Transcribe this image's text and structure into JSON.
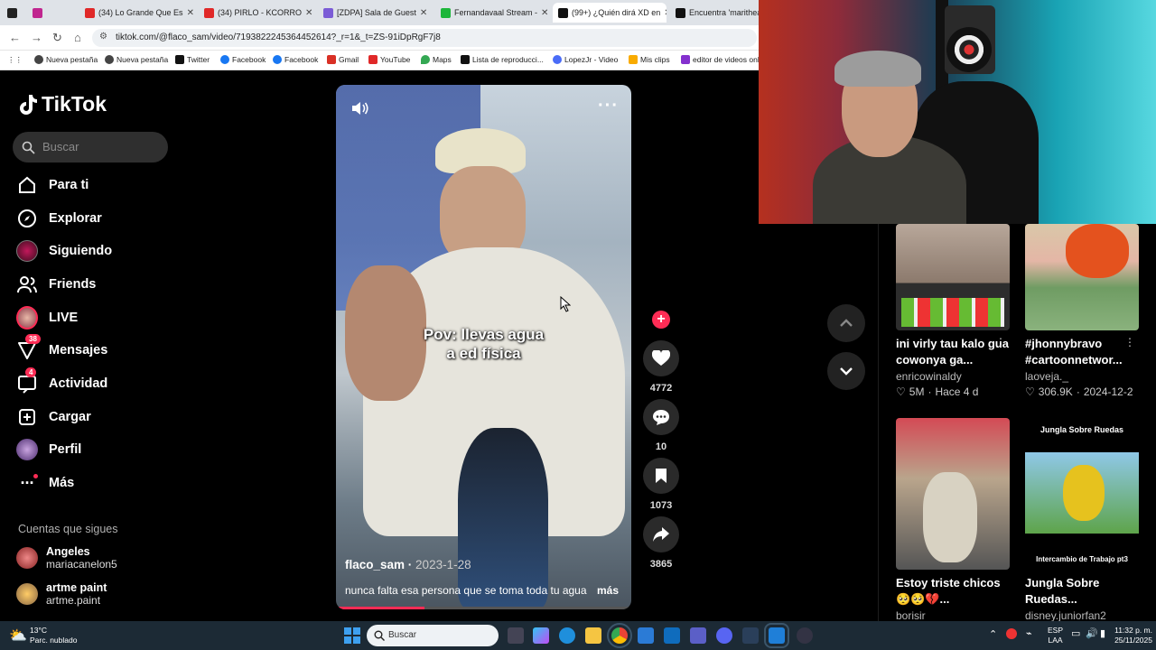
{
  "browser": {
    "tabs": [
      {
        "label": "(34) Lo Grande Que Es",
        "color": "#e02828"
      },
      {
        "label": "(34) PIRLO - KCORRO",
        "color": "#e02828"
      },
      {
        "label": "[ZDPA] Sala de Guest",
        "color": "#7b5cd6"
      },
      {
        "label": "Fernandavaal Stream -",
        "color": "#1cb63a"
      },
      {
        "label": "(99+) ¿Quién dirá XD en",
        "color": "#111111"
      },
      {
        "label": "Encuentra 'marithea",
        "color": "#111111"
      }
    ],
    "url": "tiktok.com/@flaco_sam/video/7193822245364452614?_r=1&_t=ZS-91iDpRgF7j8",
    "bookmarks": [
      "Nueva pestaña",
      "Nueva pestaña",
      "Twitter",
      "Facebook",
      "Facebook",
      "Gmail",
      "YouTube",
      "Maps",
      "Lista de reproducci...",
      "LopezJr - Video",
      "Mis clips",
      "editor de videos onl"
    ]
  },
  "tiktok": {
    "logo": "TikTok",
    "search_placeholder": "Buscar",
    "nav": [
      {
        "label": "Para ti",
        "icon": "home-icon"
      },
      {
        "label": "Explorar",
        "icon": "compass-icon"
      },
      {
        "label": "Siguiendo",
        "icon": "following-avatar"
      },
      {
        "label": "Friends",
        "icon": "friends-icon"
      },
      {
        "label": "LIVE",
        "icon": "live-avatar"
      },
      {
        "label": "Mensajes",
        "icon": "messages-icon",
        "badge": "38"
      },
      {
        "label": "Actividad",
        "icon": "activity-icon",
        "badge": "4"
      },
      {
        "label": "Cargar",
        "icon": "upload-icon"
      },
      {
        "label": "Perfil",
        "icon": "profile-avatar"
      },
      {
        "label": "Más",
        "icon": "more-icon"
      }
    ],
    "following_heading": "Cuentas que sigues",
    "following": [
      {
        "name": "Angeles",
        "handle": "mariacanelon5"
      },
      {
        "name": "artme paint",
        "handle": "artme.paint"
      }
    ]
  },
  "video": {
    "overlay_text_line1": "Pov: llevas agua",
    "overlay_text_line2": "a ed física",
    "author": "flaco_sam",
    "date": "2023-1-28",
    "description": "nunca falta esa persona que se toma toda tu agua",
    "more": "más",
    "progress": 0.3,
    "likes": "4772",
    "comments": "10",
    "saves": "1073",
    "shares": "3865"
  },
  "related": [
    {
      "title": "ini virly tau kalo gua cowonya ga...",
      "user": "enricowinaldy",
      "views": "5M",
      "age": "Hace 4 d"
    },
    {
      "title": "#jhonnybravo #cartoonnetwor...",
      "user": "laoveja._",
      "views": "306.9K",
      "age": "2024-12-2"
    },
    {
      "title": "Estoy triste chicos 🥺🥺💔...",
      "user": "borisir",
      "views": "",
      "age": ""
    },
    {
      "title": "Jungla Sobre Ruedas...",
      "user": "disney.juniorfan2",
      "thumb_top": "Jungla Sobre Ruedas",
      "thumb_bottom": "Intercambio de Trabajo pt3",
      "views": "",
      "age": ""
    }
  ],
  "taskbar": {
    "weather_temp": "13°C",
    "weather_desc": "Parc. nublado",
    "search": "Buscar",
    "lang1": "ESP",
    "lang2": "LAA",
    "time": "11:32 p. m.",
    "date": "25/11/2025"
  },
  "colors": {
    "accent": "#fe2c55",
    "background": "#000000",
    "taskbar": "#1c2a35"
  }
}
